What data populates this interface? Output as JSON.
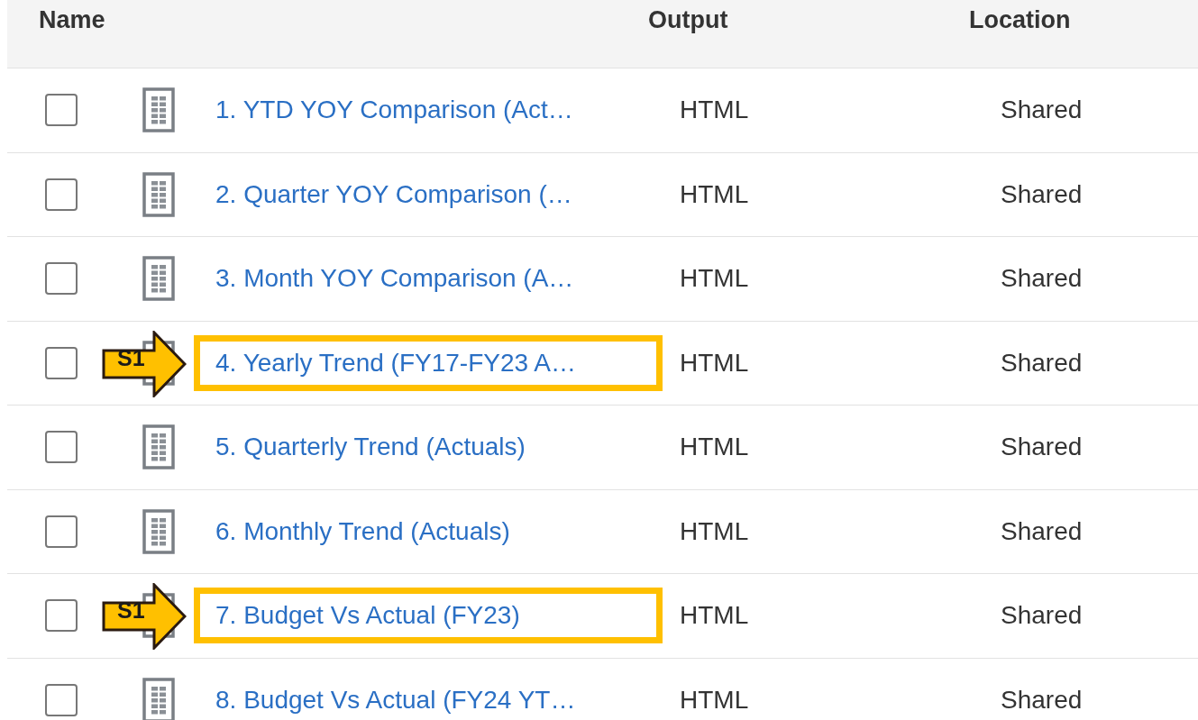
{
  "table": {
    "columns": [
      "Name",
      "Output",
      "Location"
    ],
    "rows": [
      {
        "checked": false,
        "name": "1. YTD YOY Comparison (Act…",
        "output": "HTML",
        "location": "Shared"
      },
      {
        "checked": false,
        "name": "2. Quarter YOY Comparison (…",
        "output": "HTML",
        "location": "Shared"
      },
      {
        "checked": false,
        "name": "3. Month YOY Comparison (A…",
        "output": "HTML",
        "location": "Shared"
      },
      {
        "checked": false,
        "name": "4. Yearly Trend (FY17-FY23 A…",
        "output": "HTML",
        "location": "Shared",
        "callout": "S1"
      },
      {
        "checked": false,
        "name": "5. Quarterly Trend (Actuals)",
        "output": "HTML",
        "location": "Shared"
      },
      {
        "checked": false,
        "name": "6. Monthly Trend (Actuals)",
        "output": "HTML",
        "location": "Shared"
      },
      {
        "checked": false,
        "name": "7. Budget Vs Actual (FY23)",
        "output": "HTML",
        "location": "Shared",
        "callout": "S1"
      },
      {
        "checked": false,
        "name": "8. Budget Vs Actual (FY24 YT…",
        "output": "HTML",
        "location": "Shared"
      }
    ]
  }
}
